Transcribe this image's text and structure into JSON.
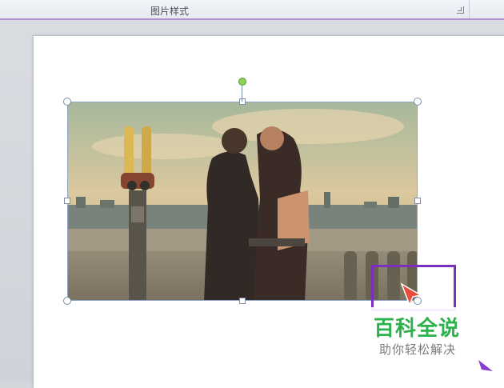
{
  "ribbon": {
    "group_label": "图片样式"
  },
  "watermark": {
    "title": "百科全说",
    "subtitle": "助你轻松解决"
  },
  "colors": {
    "ribbon_underline": "#b78fd0",
    "selection_border": "#8fa5c7",
    "rotate_handle": "#8bd15a",
    "highlight_box": "#7b2fbf",
    "watermark_title": "#2bb24c",
    "cursor_purple": "#8a3bd0",
    "cursor_red": "#e84c3d"
  },
  "icons": [
    "dialog-launcher-icon",
    "rotate-handle-icon",
    "resize-handle-icon",
    "pointer-cursor-icon"
  ]
}
